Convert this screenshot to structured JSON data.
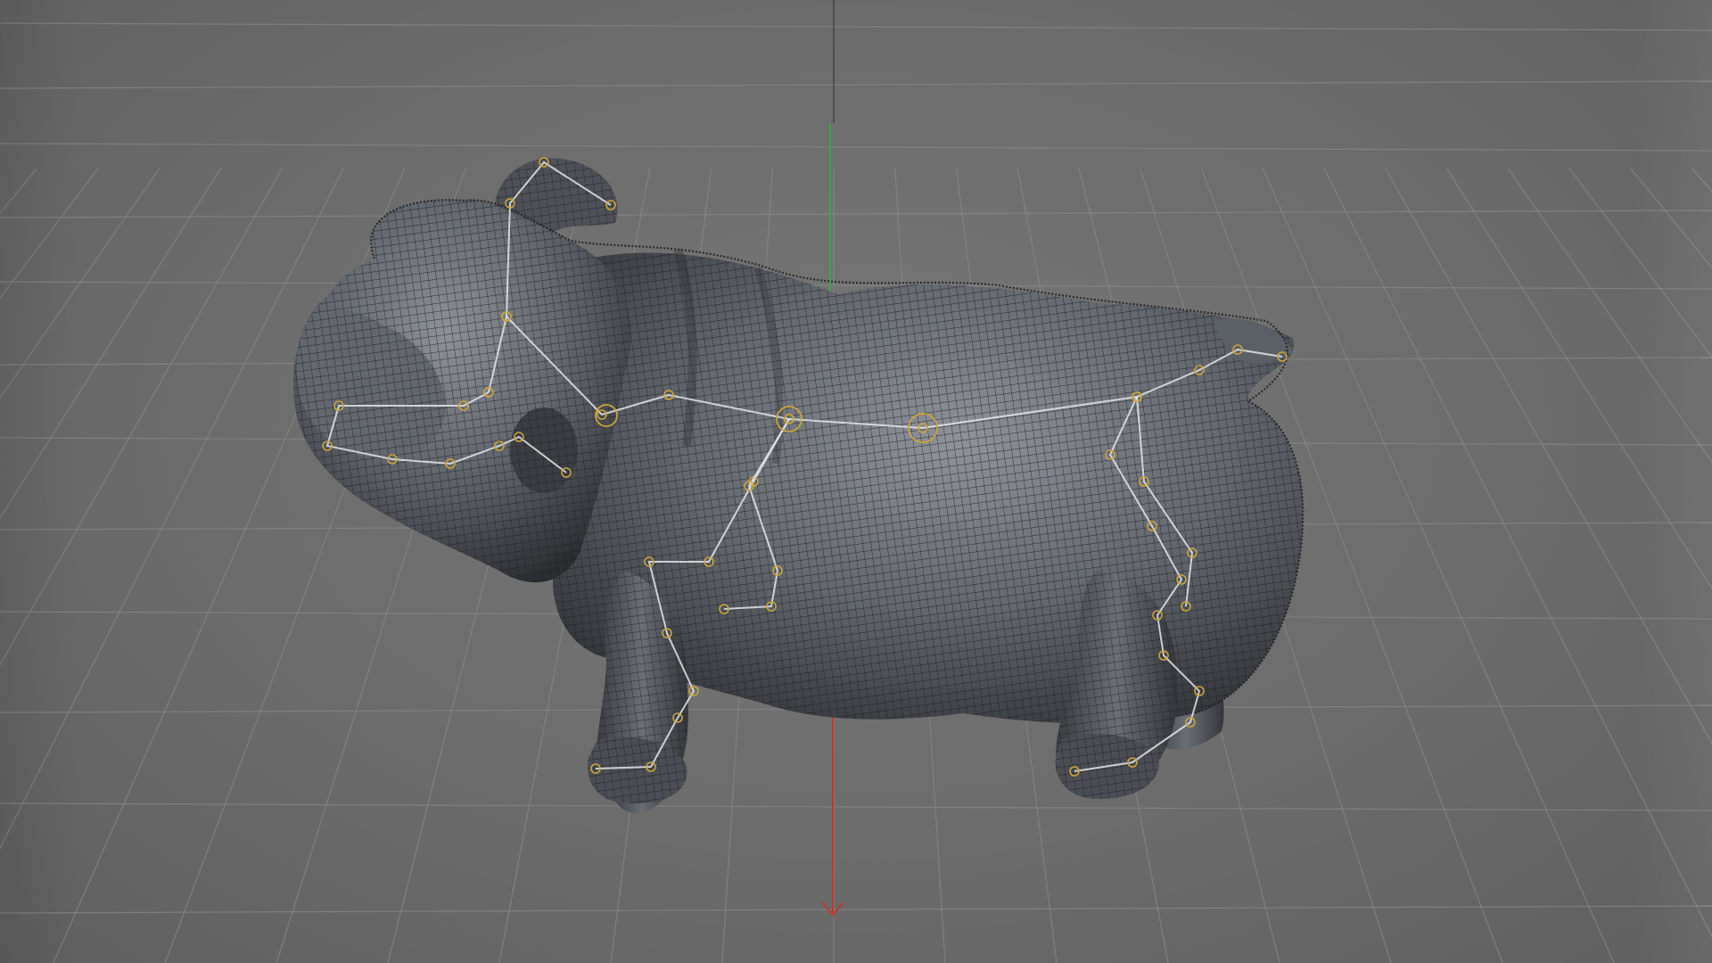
{
  "viewport": {
    "label": "",
    "background_color": "#6b6b6b",
    "grid_color": "#8a8a8a",
    "axis_y_color": "#3fa34d",
    "axis_x_color": "#c0392b"
  },
  "model": {
    "type": "bulldog-mesh-with-skeleton-rig",
    "mesh_color": "#5a5d63",
    "wire_color": "#1b1c1f",
    "bone_color": "#e6e6ea",
    "joint_color": "#c9a53a",
    "visible_text": []
  }
}
